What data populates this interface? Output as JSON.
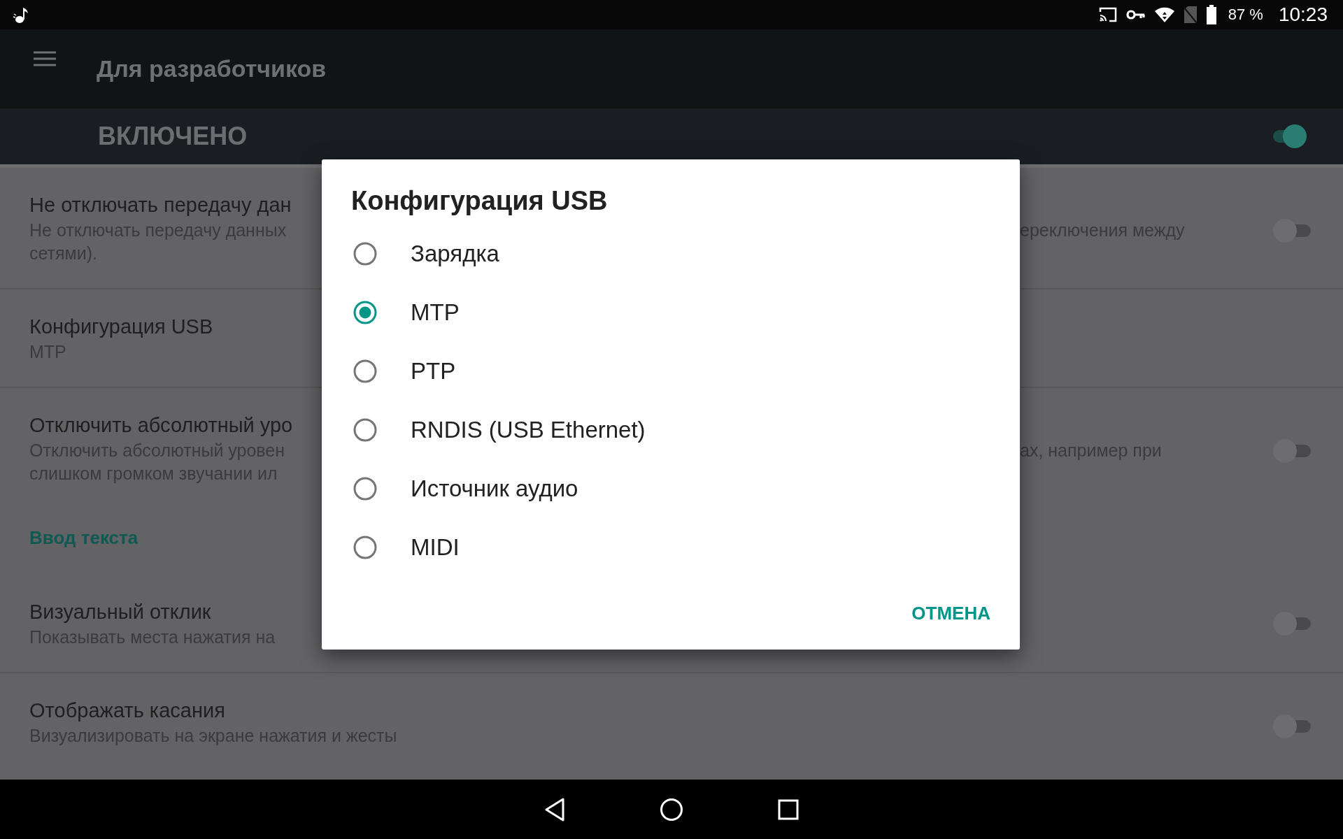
{
  "status_bar": {
    "battery_text": "87 %",
    "time": "10:23"
  },
  "toolbar": {
    "title": "Для разработчиков"
  },
  "master_switch": {
    "label": "ВКЛЮЧЕНО",
    "on": true
  },
  "settings": [
    {
      "kind": "setting",
      "title": "Не отключать передачу дан",
      "summary_left": [
        "Не отключать передачу данных",
        "сетями)."
      ],
      "summary_right": "ереключения между",
      "on": false
    },
    {
      "kind": "setting",
      "title": "Конфигурация USB",
      "summary_left": [
        "MTP"
      ]
    },
    {
      "kind": "setting",
      "title": "Отключить абсолютный уро",
      "summary_left": [
        "Отключить абсолютный уровен",
        "слишком громком звучании ил"
      ],
      "summary_right": "ах, например при",
      "on": false
    },
    {
      "kind": "header",
      "title": "Ввод текста"
    },
    {
      "kind": "setting",
      "title": "Визуальный отклик",
      "summary_left": [
        "Показывать места нажатия на"
      ],
      "on": false
    },
    {
      "kind": "setting",
      "title": "Отображать касания",
      "summary_left": [
        "Визуализировать на экране нажатия и жесты"
      ],
      "on": false
    }
  ],
  "dialog": {
    "title": "Конфигурация USB",
    "options": [
      {
        "label": "Зарядка",
        "selected": false
      },
      {
        "label": "MTP",
        "selected": true
      },
      {
        "label": "PTP",
        "selected": false
      },
      {
        "label": "RNDIS (USB Ethernet)",
        "selected": false
      },
      {
        "label": "Источник аудио",
        "selected": false
      },
      {
        "label": "MIDI",
        "selected": false
      }
    ],
    "button": "ОТМЕНА"
  }
}
